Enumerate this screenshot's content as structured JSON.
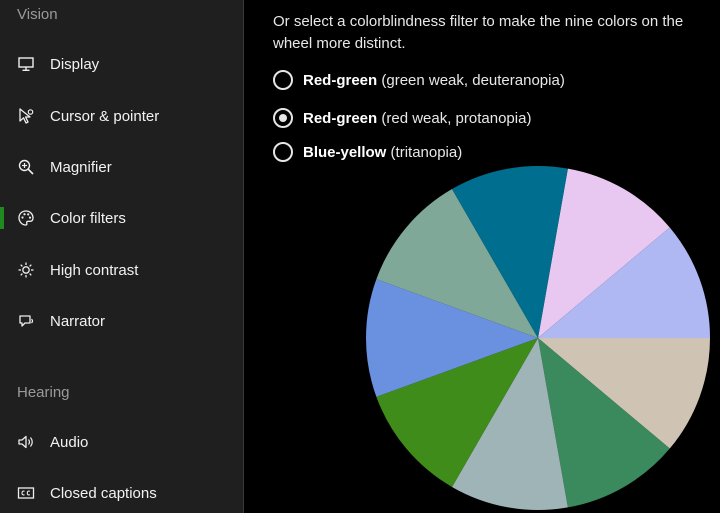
{
  "sidebar": {
    "vision_title": "Vision",
    "hearing_title": "Hearing",
    "items": [
      {
        "label": "Display",
        "icon": "monitor-icon"
      },
      {
        "label": "Cursor & pointer",
        "icon": "cursor-icon"
      },
      {
        "label": "Magnifier",
        "icon": "magnifier-icon"
      },
      {
        "label": "Color filters",
        "icon": "palette-icon",
        "selected": true
      },
      {
        "label": "High contrast",
        "icon": "sun-icon"
      },
      {
        "label": "Narrator",
        "icon": "narrator-icon"
      },
      {
        "label": "Audio",
        "icon": "speaker-icon"
      },
      {
        "label": "Closed captions",
        "icon": "captions-icon"
      }
    ],
    "accent_color": "#1f8a1f"
  },
  "main": {
    "intro": "Or select a colorblindness filter to make the nine colors on the wheel more distinct.",
    "options": [
      {
        "bold": "Red-green",
        "detail": "(green weak, deuteranopia)",
        "checked": false
      },
      {
        "bold": "Red-green",
        "detail": "(red weak, protanopia)",
        "checked": true
      },
      {
        "bold": "Blue-yellow",
        "detail": "(tritanopia)",
        "checked": false
      }
    ],
    "wheel_colors": [
      "#e8c8f0",
      "#b0b8f4",
      "#cfc3b4",
      "#3b8a5e",
      "#9fb4b6",
      "#3f8c1a",
      "#6a90e0",
      "#7fa898",
      "#006e8e"
    ]
  }
}
